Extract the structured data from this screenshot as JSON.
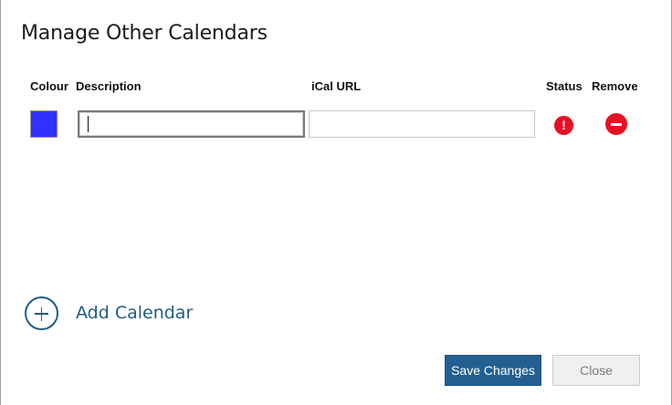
{
  "dialog": {
    "title": "Manage Other Calendars"
  },
  "columns": {
    "colour": "Colour",
    "description": "Description",
    "ical_url": "iCal URL",
    "status": "Status",
    "remove": "Remove"
  },
  "rows": [
    {
      "colour": "#3030ff",
      "description": "",
      "ical_url": "",
      "status_icon": "error-exclamation-icon",
      "status_glyph": "!",
      "remove_icon": "remove-minus-icon"
    }
  ],
  "add_calendar": {
    "label": "Add Calendar",
    "icon": "plus-circle-icon"
  },
  "buttons": {
    "save": "Save Changes",
    "close": "Close"
  },
  "colors": {
    "accent": "#236091",
    "link": "#1f5c86",
    "error": "#e81123"
  }
}
